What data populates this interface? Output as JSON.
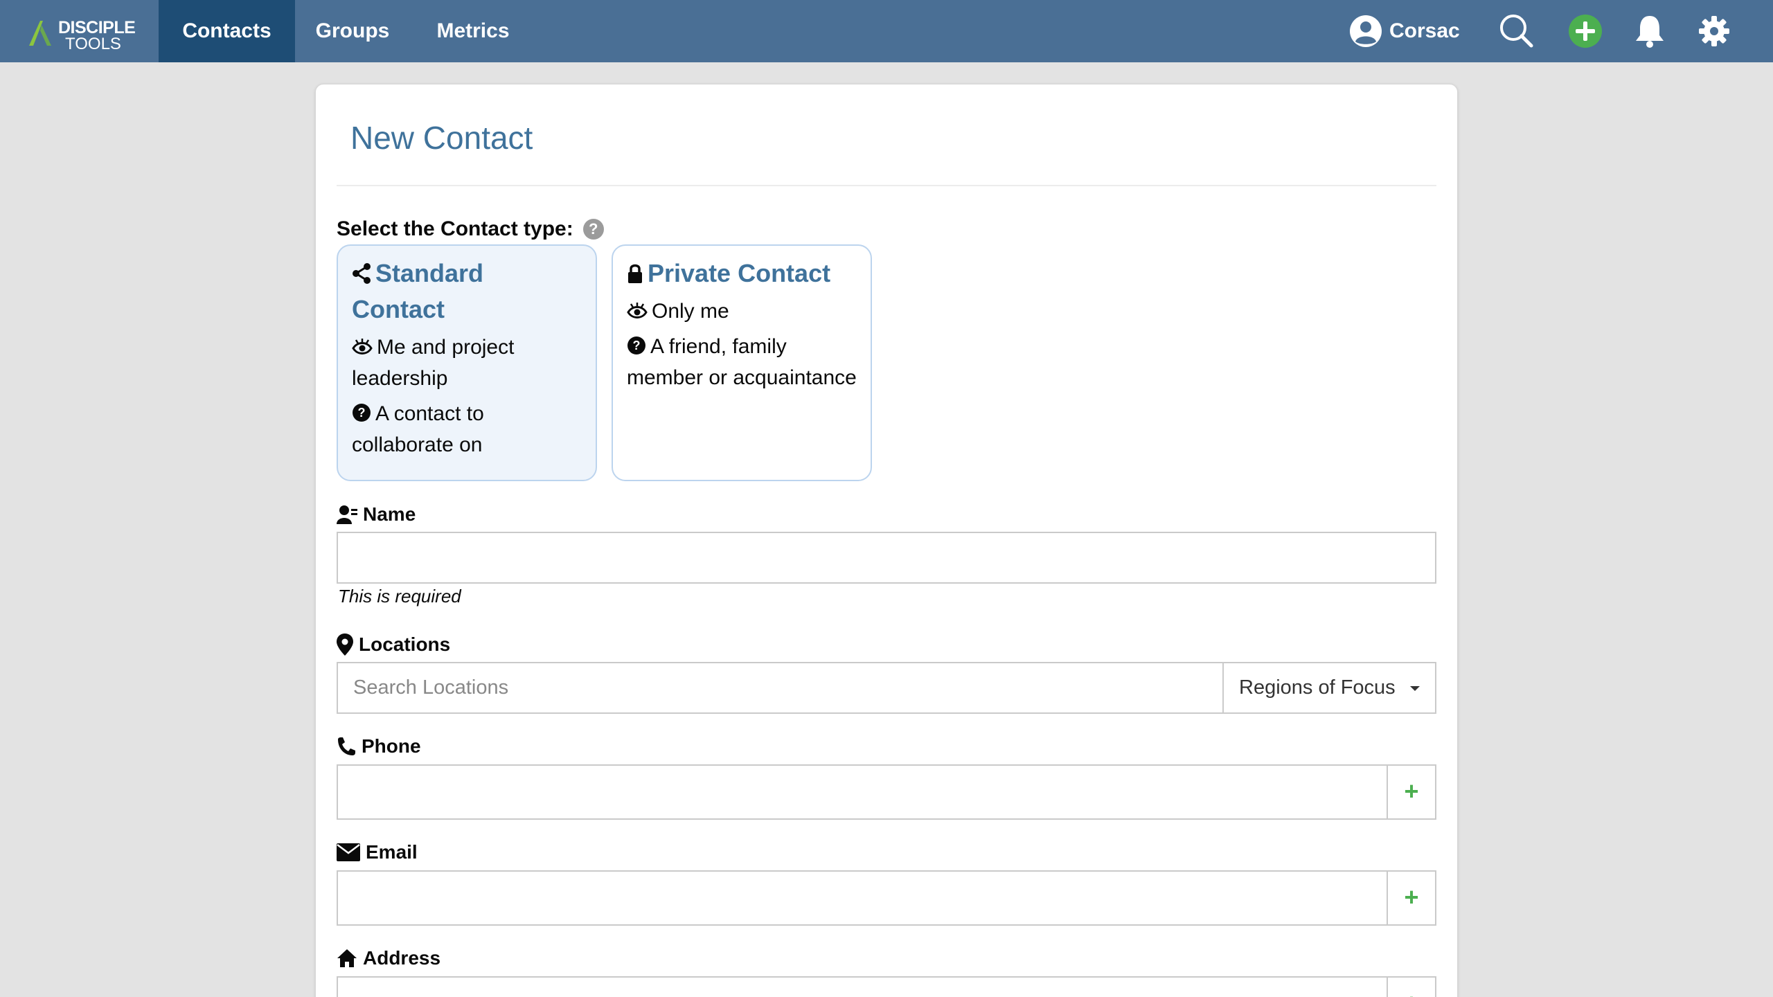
{
  "logo": {
    "line1": "DISCIPLE",
    "line2": "TOOLS"
  },
  "nav": {
    "contacts": "Contacts",
    "groups": "Groups",
    "metrics": "Metrics"
  },
  "user": {
    "name": "Corsac"
  },
  "icons": {
    "search": "search-icon",
    "add": "plus-circle-icon",
    "bell": "bell-icon",
    "settings": "gear-icon"
  },
  "colors": {
    "topbar": "#4a6f95",
    "active_nav": "#1e4d75",
    "accent": "#3f729b",
    "add_green": "#4caf50"
  },
  "page": {
    "title": "New Contact"
  },
  "contact_type": {
    "label": "Select the Contact type:",
    "help": "?",
    "options": [
      {
        "title_line1": "Standard",
        "title_line2": "Contact",
        "visibility": "Me and project leadership",
        "description": "A contact to collaborate on",
        "selected": true
      },
      {
        "title": "Private Contact",
        "visibility": "Only me",
        "description": "A friend, family member or acquaintance",
        "selected": false
      }
    ]
  },
  "fields": {
    "name": {
      "label": "Name",
      "value": "",
      "hint": "This is required"
    },
    "locations": {
      "label": "Locations",
      "placeholder": "Search Locations",
      "filter": "Regions of Focus"
    },
    "phone": {
      "label": "Phone",
      "value": "",
      "add": "+"
    },
    "email": {
      "label": "Email",
      "value": "",
      "add": "+"
    },
    "address": {
      "label": "Address",
      "value": "",
      "add": "+"
    }
  }
}
